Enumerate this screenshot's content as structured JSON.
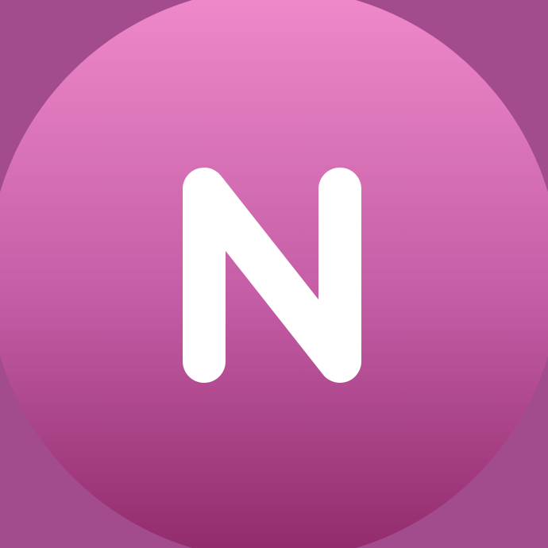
{
  "icon": {
    "name": "letter-n-app-icon",
    "letter": "N",
    "colors": {
      "background": "#a24c8d",
      "circle_top": "#f08acb",
      "circle_mid": "#c35ca4",
      "circle_bottom": "#902a6a",
      "letter": "#ffffff"
    }
  }
}
